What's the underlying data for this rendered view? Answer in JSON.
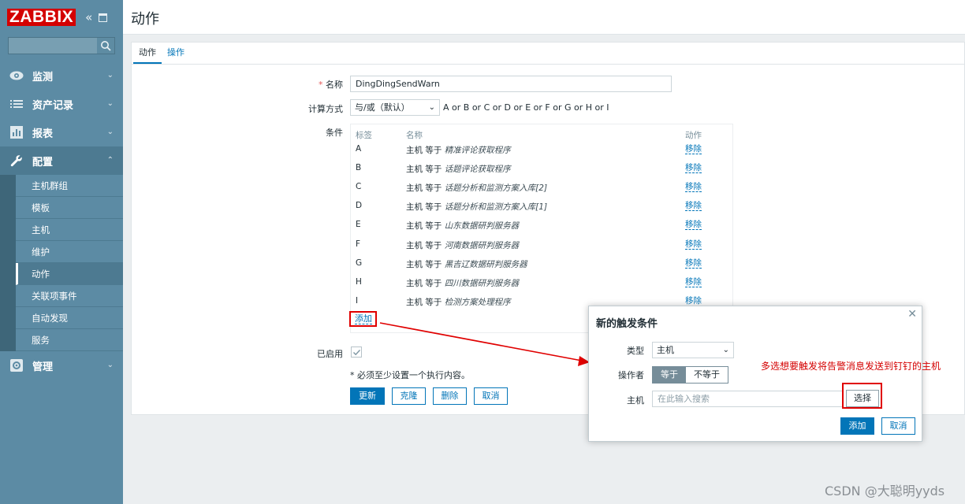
{
  "brand": {
    "logo": "ZABBIX"
  },
  "sidebar": {
    "search_placeholder": "",
    "items": [
      {
        "label": "监测",
        "icon": "eye-icon"
      },
      {
        "label": "资产记录",
        "icon": "list-icon"
      },
      {
        "label": "报表",
        "icon": "bar-chart-icon"
      },
      {
        "label": "配置",
        "icon": "wrench-icon"
      },
      {
        "label": "管理",
        "icon": "gear-icon"
      }
    ],
    "subitems": [
      "主机群组",
      "模板",
      "主机",
      "维护",
      "动作",
      "关联项事件",
      "自动发现",
      "服务"
    ]
  },
  "header": {
    "title": "动作"
  },
  "tabs": [
    "动作",
    "操作"
  ],
  "form": {
    "name_label": "名称",
    "name_value": "DingDingSendWarn",
    "calc_label": "计算方式",
    "calc_value": "与/或（默认）",
    "calc_formula": "A or B or C or D or E or F or G or H or I",
    "cond_label": "条件",
    "cond_headers": {
      "label": "标签",
      "name": "名称",
      "action": "动作"
    },
    "conditions": [
      {
        "label": "A",
        "prefix": "主机 等于",
        "value": "精准评论获取程序",
        "remove": "移除"
      },
      {
        "label": "B",
        "prefix": "主机 等于",
        "value": "话题评论获取程序",
        "remove": "移除"
      },
      {
        "label": "C",
        "prefix": "主机 等于",
        "value": "话题分析和监测方案入库[2]",
        "remove": "移除"
      },
      {
        "label": "D",
        "prefix": "主机 等于",
        "value": "话题分析和监测方案入库[1]",
        "remove": "移除"
      },
      {
        "label": "E",
        "prefix": "主机 等于",
        "value": "山东数据研判服务器",
        "remove": "移除"
      },
      {
        "label": "F",
        "prefix": "主机 等于",
        "value": "河南数据研判服务器",
        "remove": "移除"
      },
      {
        "label": "G",
        "prefix": "主机 等于",
        "value": "黑吉辽数据研判服务器",
        "remove": "移除"
      },
      {
        "label": "H",
        "prefix": "主机 等于",
        "value": "四川数据研判服务器",
        "remove": "移除"
      },
      {
        "label": "I",
        "prefix": "主机 等于",
        "value": "检测方案处理程序",
        "remove": "移除"
      }
    ],
    "add_link": "添加",
    "enabled_label": "已启用",
    "hint": "* 必须至少设置一个执行内容。",
    "buttons": {
      "update": "更新",
      "clone": "克隆",
      "delete": "删除",
      "cancel": "取消"
    }
  },
  "dialog": {
    "title": "新的触发条件",
    "type_label": "类型",
    "type_value": "主机",
    "operator_label": "操作者",
    "op_equals": "等于",
    "op_not_equals": "不等于",
    "host_label": "主机",
    "host_placeholder": "在此输入搜索",
    "select_button": "选择",
    "add_button": "添加",
    "cancel_button": "取消"
  },
  "annotation": "多选想要触发将告警消息发送到钉钉的主机",
  "watermark": "CSDN @大聪明yyds",
  "colors": {
    "sidebar": "#5c8ba4",
    "accent": "#0275b8",
    "logo_red": "#d40000",
    "annotation_red": "#e00000"
  }
}
